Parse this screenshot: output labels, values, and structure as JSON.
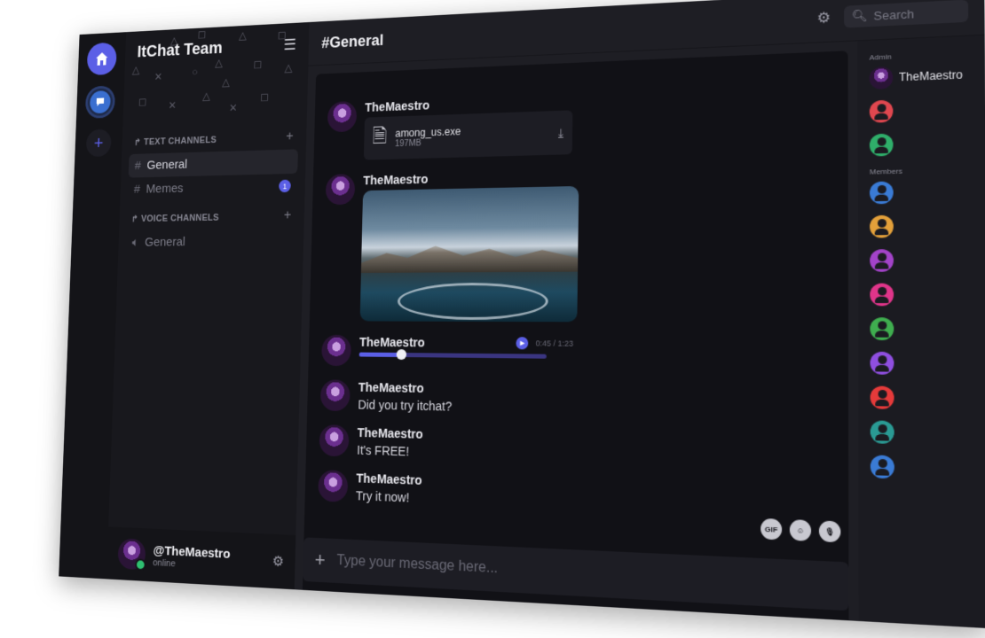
{
  "app": {
    "team_name": "ItChat Team",
    "channel_title": "#General"
  },
  "search": {
    "placeholder": "Search"
  },
  "sidebar": {
    "text_category": "TEXT CHANNELS",
    "voice_category": "VOICE CHANNELS",
    "text_channels": [
      {
        "name": "General",
        "active": true
      },
      {
        "name": "Memes",
        "badge": "1"
      }
    ],
    "voice_channels": [
      {
        "name": "General"
      }
    ]
  },
  "user": {
    "handle": "@TheMaestro",
    "status": "online"
  },
  "messages": [
    {
      "author": "TheMaestro",
      "type": "file",
      "file_name": "among_us.exe",
      "file_size": "197MB"
    },
    {
      "author": "TheMaestro",
      "type": "image"
    },
    {
      "author": "TheMaestro",
      "type": "audio",
      "time": "0:45 / 1:23",
      "progress": 0.23
    },
    {
      "author": "TheMaestro",
      "type": "text",
      "text": "Did you try itchat?"
    },
    {
      "author": "TheMaestro",
      "type": "text",
      "text": "It's FREE!"
    },
    {
      "author": "TheMaestro",
      "type": "text",
      "text": "Try it now!"
    }
  ],
  "composer": {
    "placeholder": "Type your message here...",
    "gif_label": "GIF"
  },
  "members": {
    "admin_label": "Admin",
    "members_label": "Members",
    "admin": [
      {
        "name": "TheMaestro"
      },
      {
        "name": "",
        "color": "#e0474f"
      },
      {
        "name": "",
        "color": "#2fae6a"
      }
    ],
    "regular": [
      {
        "color": "#3a7bd5"
      },
      {
        "color": "#e3a03a"
      },
      {
        "color": "#a343c9"
      },
      {
        "color": "#e0358a"
      },
      {
        "color": "#3fae4f"
      },
      {
        "color": "#8f4fe0"
      },
      {
        "color": "#e53a3a"
      },
      {
        "color": "#2a9a94"
      },
      {
        "color": "#3a7bd5"
      }
    ]
  },
  "colors": {
    "accent": "#5b5fe6",
    "online": "#2fbf71"
  }
}
